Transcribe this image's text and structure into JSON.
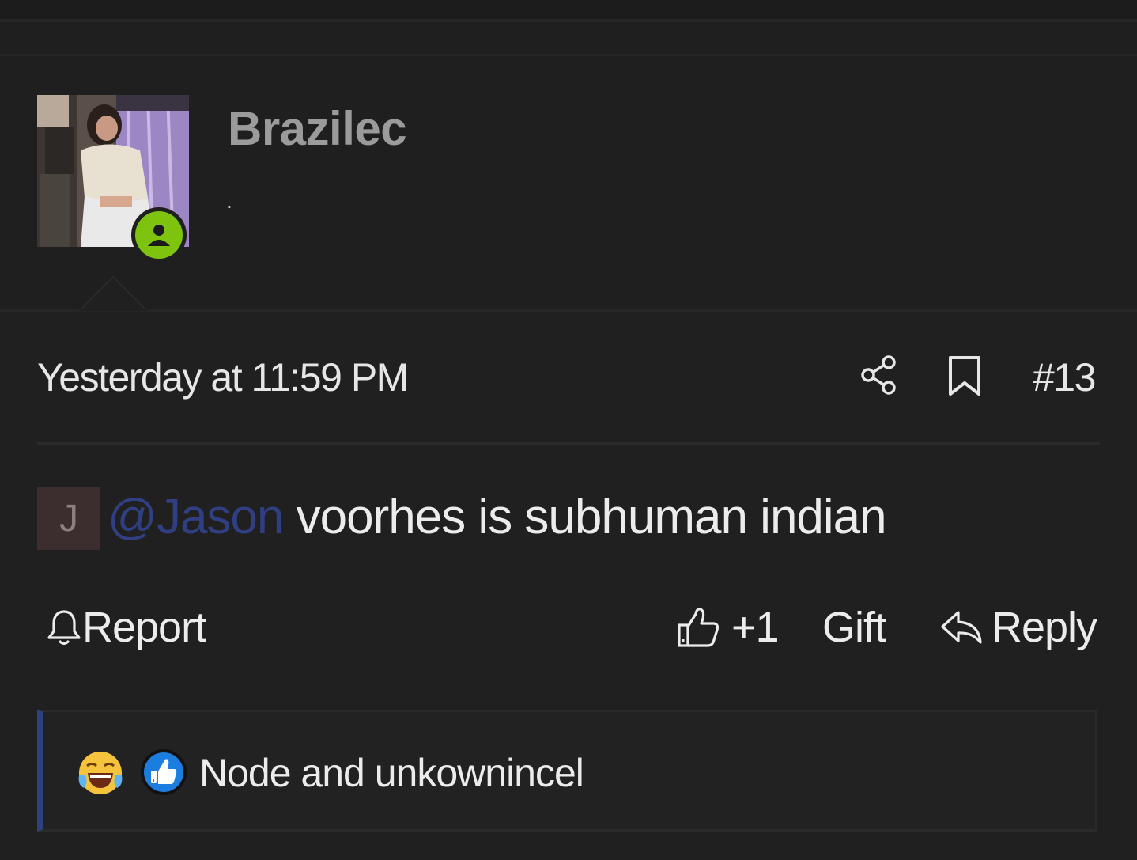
{
  "post": {
    "author": {
      "username": "Brazilec",
      "user_title": "."
    },
    "timestamp": "Yesterday at 11:59 PM",
    "post_number": "#13",
    "mention": {
      "avatar_letter": "J",
      "handle": "@Jason"
    },
    "message_text": " voorhes is subhuman indian",
    "actions": {
      "report_label": "Report",
      "like_label": "+1",
      "gift_label": "Gift",
      "reply_label": "Reply"
    },
    "reactions": {
      "summary": "Node and unkownincel"
    }
  },
  "colors": {
    "background": "#202020",
    "username": "#9b9b9b",
    "online_badge": "#7ec40e",
    "mention_link": "#2f3f82",
    "reaction_bar_accent": "#2e4180"
  },
  "icons": [
    "online-status-icon",
    "share-icon",
    "bookmark-icon",
    "bell-icon",
    "thumbs-up-icon",
    "reply-icon",
    "laughing-tears-emoji-icon",
    "like-reaction-icon"
  ]
}
